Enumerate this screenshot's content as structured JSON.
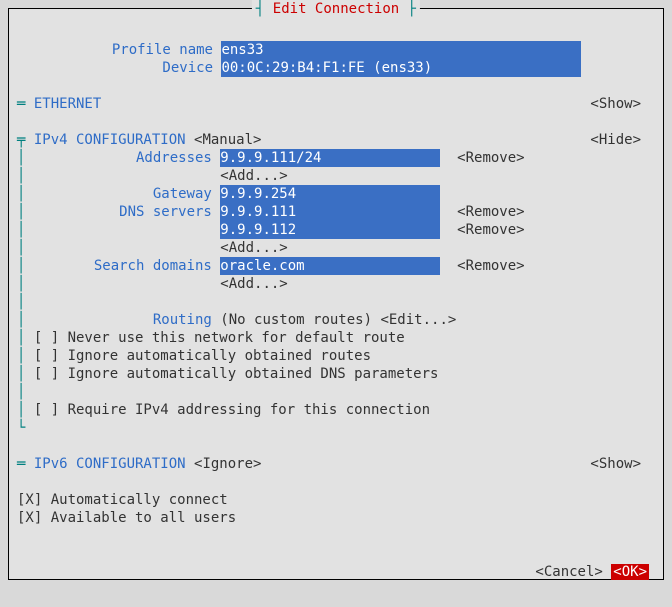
{
  "title": "Edit Connection",
  "profile": {
    "name_label": "Profile name",
    "name_value": "ens33",
    "device_label": "Device",
    "device_value": "00:0C:29:B4:F1:FE (ens33)"
  },
  "ethernet": {
    "heading": "ETHERNET",
    "toggle": "<Show>"
  },
  "ipv4": {
    "heading": "IPv4 CONFIGURATION",
    "mode": "<Manual>",
    "toggle": "<Hide>",
    "addresses_label": "Addresses",
    "addresses": [
      "9.9.9.111/24"
    ],
    "add": "<Add...>",
    "remove": "<Remove>",
    "gateway_label": "Gateway",
    "gateway": "9.9.9.254",
    "dns_label": "DNS servers",
    "dns": [
      "9.9.9.111",
      "9.9.9.112"
    ],
    "search_label": "Search domains",
    "search": [
      "oracle.com"
    ],
    "routing_label": "Routing",
    "routing_text": "(No custom routes)",
    "routing_edit": "<Edit...>",
    "opt1": "[ ] Never use this network for default route",
    "opt2": "[ ] Ignore automatically obtained routes",
    "opt3": "[ ] Ignore automatically obtained DNS parameters",
    "opt4": "[ ] Require IPv4 addressing for this connection"
  },
  "ipv6": {
    "heading": "IPv6 CONFIGURATION",
    "mode": "<Ignore>",
    "toggle": "<Show>"
  },
  "global": {
    "auto": "[X] Automatically connect",
    "all": "[X] Available to all users"
  },
  "buttons": {
    "cancel": "<Cancel>",
    "ok": "<OK>"
  }
}
